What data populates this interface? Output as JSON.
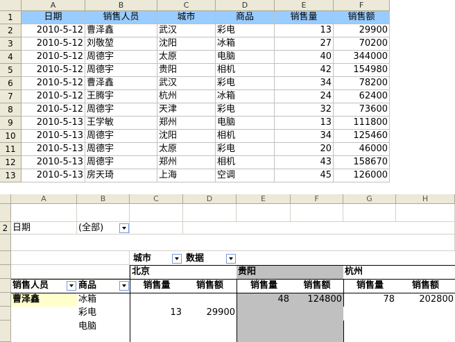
{
  "sheet": {
    "col_headers": [
      "A",
      "B",
      "C",
      "D",
      "E",
      "F"
    ],
    "row_numbers": [
      "1",
      "2",
      "3",
      "4",
      "5",
      "6",
      "7",
      "8",
      "9",
      "10",
      "11",
      "12",
      "13"
    ],
    "table_headers": [
      "日期",
      "销售人员",
      "城市",
      "商品",
      "销售量",
      "销售额"
    ],
    "rows": [
      [
        "2010-5-12",
        "曹泽鑫",
        "武汉",
        "彩电",
        "13",
        "29900"
      ],
      [
        "2010-5-12",
        "刘敬堃",
        "沈阳",
        "冰箱",
        "27",
        "70200"
      ],
      [
        "2010-5-12",
        "周德宇",
        "太原",
        "电脑",
        "40",
        "344000"
      ],
      [
        "2010-5-12",
        "周德宇",
        "贵阳",
        "相机",
        "42",
        "154980"
      ],
      [
        "2010-5-12",
        "曹泽鑫",
        "武汉",
        "彩电",
        "34",
        "78200"
      ],
      [
        "2010-5-12",
        "王腾宇",
        "杭州",
        "冰箱",
        "24",
        "62400"
      ],
      [
        "2010-5-12",
        "周德宇",
        "天津",
        "彩电",
        "32",
        "73600"
      ],
      [
        "2010-5-13",
        "王学敏",
        "郑州",
        "电脑",
        "13",
        "111800"
      ],
      [
        "2010-5-13",
        "周德宇",
        "沈阳",
        "相机",
        "34",
        "125460"
      ],
      [
        "2010-5-13",
        "周德宇",
        "太原",
        "彩电",
        "20",
        "46000"
      ],
      [
        "2010-5-13",
        "周德宇",
        "郑州",
        "相机",
        "43",
        "158670"
      ],
      [
        "2010-5-13",
        "房天琦",
        "上海",
        "空调",
        "45",
        "126000"
      ]
    ]
  },
  "pivot": {
    "col_headers": [
      "A",
      "B",
      "C",
      "D",
      "E",
      "F",
      "G",
      "H"
    ],
    "row_numbers": [
      "",
      "2",
      "",
      "",
      "",
      "",
      "",
      ""
    ],
    "page_field_label": "日期",
    "page_field_value": "(全部)",
    "column_field_label": "城市",
    "data_field_label": "数据",
    "cities": [
      "北京",
      "贵阳",
      "杭州"
    ],
    "measure_labels": [
      "销售量",
      "销售额",
      "销售量",
      "销售额",
      "销售量",
      "销售额"
    ],
    "row_field_label": "销售人员",
    "row_field2_label": "商品",
    "salesperson": "曹泽鑫",
    "items": [
      "冰箱",
      "彩电",
      "电脑"
    ],
    "values": {
      "row1": [
        "",
        "",
        "48",
        "124800",
        "78",
        "202800"
      ],
      "row2": [
        "13",
        "29900",
        "",
        "",
        "",
        ""
      ]
    }
  }
}
